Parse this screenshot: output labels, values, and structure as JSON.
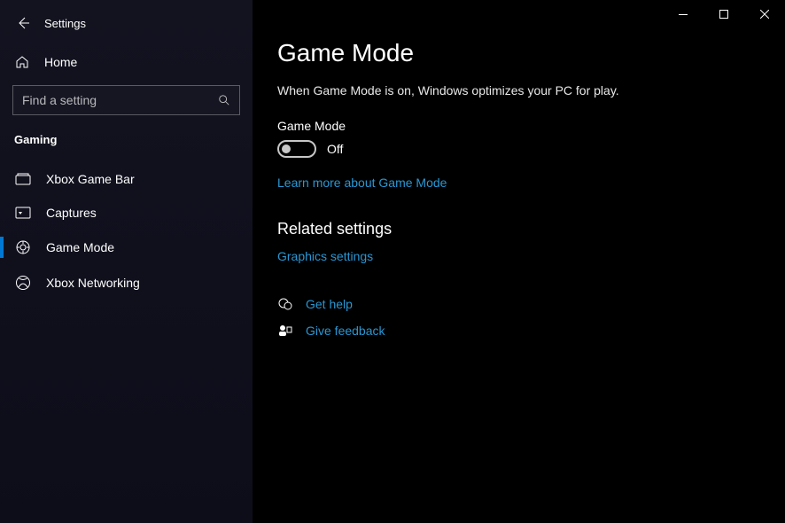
{
  "window": {
    "title": "Settings"
  },
  "sidebar": {
    "home_label": "Home",
    "search_placeholder": "Find a setting",
    "category": "Gaming",
    "items": [
      {
        "label": "Xbox Game Bar",
        "icon": "game-bar"
      },
      {
        "label": "Captures",
        "icon": "captures"
      },
      {
        "label": "Game Mode",
        "icon": "game-mode",
        "active": true
      },
      {
        "label": "Xbox Networking",
        "icon": "xbox"
      }
    ]
  },
  "main": {
    "title": "Game Mode",
    "description": "When Game Mode is on, Windows optimizes your PC for play.",
    "toggle": {
      "label": "Game Mode",
      "state": "Off"
    },
    "learn_more": "Learn more about Game Mode",
    "related": {
      "heading": "Related settings",
      "graphics": "Graphics settings"
    },
    "help": {
      "get_help": "Get help",
      "feedback": "Give feedback"
    }
  }
}
